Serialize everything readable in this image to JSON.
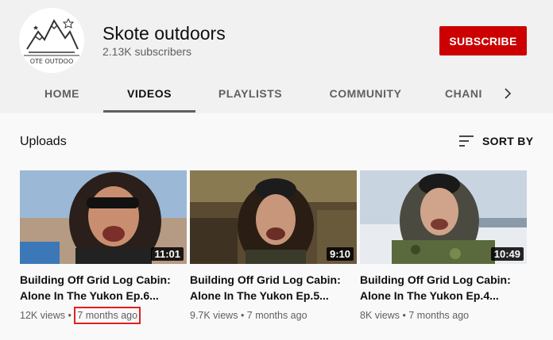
{
  "channel": {
    "name": "Skote outdoors",
    "subscribers": "2.13K subscribers",
    "avatar_text": "OTE OUTDOO"
  },
  "subscribe_label": "SUBSCRIBE",
  "tabs": [
    {
      "label": "HOME",
      "active": false
    },
    {
      "label": "VIDEOS",
      "active": true
    },
    {
      "label": "PLAYLISTS",
      "active": false
    },
    {
      "label": "COMMUNITY",
      "active": false
    },
    {
      "label": "CHANI",
      "active": false
    }
  ],
  "section": {
    "title": "Uploads",
    "sort_label": "SORT BY"
  },
  "videos": [
    {
      "title_line1": "Building Off Grid Log Cabin:",
      "title_line2": "Alone In The Yukon Ep.6...",
      "views": "12K views",
      "age": "7 months ago",
      "duration": "11:01"
    },
    {
      "title_line1": "Building Off Grid Log Cabin:",
      "title_line2": "Alone In The Yukon Ep.5...",
      "views": "9.7K views",
      "age": "7 months ago",
      "duration": "9:10"
    },
    {
      "title_line1": "Building Off Grid Log Cabin:",
      "title_line2": "Alone In The Yukon Ep.4...",
      "views": "8K views",
      "age": "7 months ago",
      "duration": "10:49"
    }
  ],
  "colors": {
    "subscribe_bg": "#cc0000",
    "highlight_border": "#e02020",
    "header_bg": "#f1f1f1",
    "page_bg": "#f9f9f9"
  }
}
